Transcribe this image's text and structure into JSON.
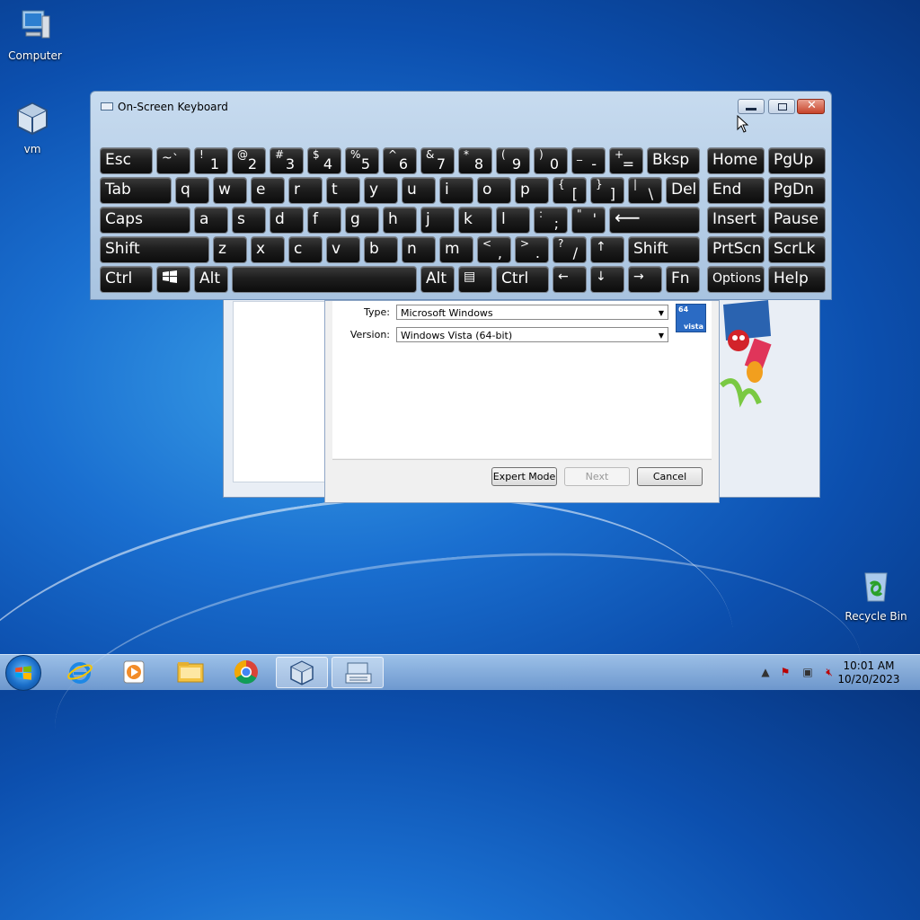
{
  "desktop": {
    "icons": [
      {
        "label": "Computer"
      },
      {
        "label": "vm"
      },
      {
        "label": "Recycle Bin"
      }
    ]
  },
  "wizard": {
    "type_label": "Type:",
    "type_value": "Microsoft Windows",
    "version_label": "Version:",
    "version_value": "Windows Vista (64-bit)",
    "os_badge_top": "64",
    "os_badge_bottom": "vista",
    "buttons": {
      "expert": "Expert Mode",
      "next": "Next",
      "cancel": "Cancel"
    }
  },
  "osk": {
    "title": "On-Screen Keyboard",
    "keys": {
      "esc": "Esc",
      "tilde_sh": "~",
      "tilde": "`",
      "k1_sh": "!",
      "k1": "1",
      "k2_sh": "@",
      "k2": "2",
      "k3_sh": "#",
      "k3": "3",
      "k4_sh": "$",
      "k4": "4",
      "k5_sh": "%",
      "k5": "5",
      "k6_sh": "^",
      "k6": "6",
      "k7_sh": "&",
      "k7": "7",
      "k8_sh": "*",
      "k8": "8",
      "k9_sh": "(",
      "k9": "9",
      "k0_sh": ")",
      "k0": "0",
      "minus_sh": "_",
      "minus": "-",
      "eq_sh": "+",
      "eq": "=",
      "bksp": "Bksp",
      "home": "Home",
      "pgup": "PgUp",
      "tab": "Tab",
      "q": "q",
      "w": "w",
      "e": "e",
      "r": "r",
      "t": "t",
      "y": "y",
      "u": "u",
      "i": "i",
      "o": "o",
      "p": "p",
      "lbr_sh": "{",
      "lbr": "[",
      "rbr_sh": "}",
      "rbr": "]",
      "bs_sh": "|",
      "bs": "\\",
      "del": "Del",
      "end": "End",
      "pgdn": "PgDn",
      "caps": "Caps",
      "a": "a",
      "s": "s",
      "d": "d",
      "f": "f",
      "g": "g",
      "h": "h",
      "j": "j",
      "k": "k",
      "l": "l",
      "semi_sh": ":",
      "semi": ";",
      "quote_sh": "\"",
      "quote": "'",
      "enter": "⟵",
      "insert": "Insert",
      "pause": "Pause",
      "shift": "Shift",
      "z": "z",
      "x": "x",
      "c": "c",
      "v": "v",
      "b": "b",
      "n": "n",
      "m": "m",
      "comma_sh": "<",
      "comma": ",",
      "dot_sh": ">",
      "dot": ".",
      "slash_sh": "?",
      "slash": "/",
      "up": "↑",
      "rshift": "Shift",
      "prtscn": "PrtScn",
      "scrlk": "ScrLk",
      "ctrl": "Ctrl",
      "alt": "Alt",
      "ralt": "Alt",
      "menu": "▤",
      "rctrl": "Ctrl",
      "left": "←",
      "down": "↓",
      "right": "→",
      "fn": "Fn",
      "options": "Options",
      "help": "Help"
    }
  },
  "taskbar": {
    "time": "10:01 AM",
    "date": "10/20/2023"
  }
}
